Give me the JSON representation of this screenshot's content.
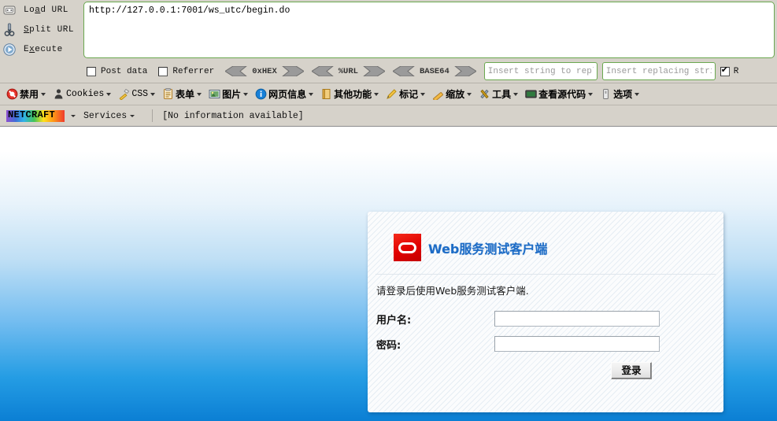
{
  "hackbar": {
    "actions": [
      {
        "icon": "load-url-icon",
        "label_pre": "Lo",
        "label_key": "a",
        "label_post": "d URL"
      },
      {
        "icon": "split-url-icon",
        "label_pre": "",
        "label_key": "S",
        "label_post": "plit URL"
      },
      {
        "icon": "execute-icon",
        "label_pre": "E",
        "label_key": "x",
        "label_post": "ecute"
      }
    ],
    "url_value": "http://127.0.0.1:7001/ws_utc/begin.do",
    "checkboxes": [
      {
        "label": "Post data",
        "checked": false
      },
      {
        "label": "Referrer",
        "checked": false
      }
    ],
    "encoders": [
      {
        "name": "0xHEX"
      },
      {
        "name": "%URL"
      },
      {
        "name": "BASE64"
      }
    ],
    "replace_from_placeholder": "Insert string to replace",
    "replace_to_placeholder": "Insert replacing string",
    "replace_all_label": "R",
    "replace_all_checked": true
  },
  "webdev_toolbar": {
    "items": [
      {
        "label": "禁用",
        "icon": "disable-icon",
        "caret": true,
        "latin": false
      },
      {
        "label": "Cookies",
        "icon": "cookies-icon",
        "caret": true,
        "latin": true
      },
      {
        "label": "CSS",
        "icon": "css-icon",
        "caret": true,
        "latin": true
      },
      {
        "label": "表单",
        "icon": "forms-icon",
        "caret": true,
        "latin": false
      },
      {
        "label": "图片",
        "icon": "images-icon",
        "caret": true,
        "latin": false
      },
      {
        "label": "网页信息",
        "icon": "info-icon",
        "caret": true,
        "latin": false
      },
      {
        "label": "其他功能",
        "icon": "misc-icon",
        "caret": true,
        "latin": false
      },
      {
        "label": "标记",
        "icon": "outline-icon",
        "caret": true,
        "latin": false
      },
      {
        "label": "缩放",
        "icon": "resize-icon",
        "caret": true,
        "latin": false
      },
      {
        "label": "工具",
        "icon": "tools-icon",
        "caret": true,
        "latin": false
      },
      {
        "label": "查看源代码",
        "icon": "view-source-icon",
        "caret": true,
        "latin": false
      },
      {
        "label": "选项",
        "icon": "options-icon",
        "caret": true,
        "latin": false
      }
    ]
  },
  "netcraft": {
    "logo_text": "NETCRAFT",
    "services_label": "Services",
    "info_text": "[No information available]"
  },
  "login": {
    "brand_title": "Web服务测试客户端",
    "subtitle": "请登录后使用Web服务测试客户端.",
    "username_label": "用户名:",
    "username_value": "",
    "password_label": "密码:",
    "password_value": "",
    "submit_label": "登录"
  },
  "colors": {
    "toolbar_bg": "#d6d2ca",
    "hackbar_input_border": "#6aa84f",
    "page_gradient_top": "#ffffff",
    "page_gradient_bottom": "#0b7fd4",
    "brand_blue": "#1d6cc6",
    "oracle_red": "#e00000"
  }
}
